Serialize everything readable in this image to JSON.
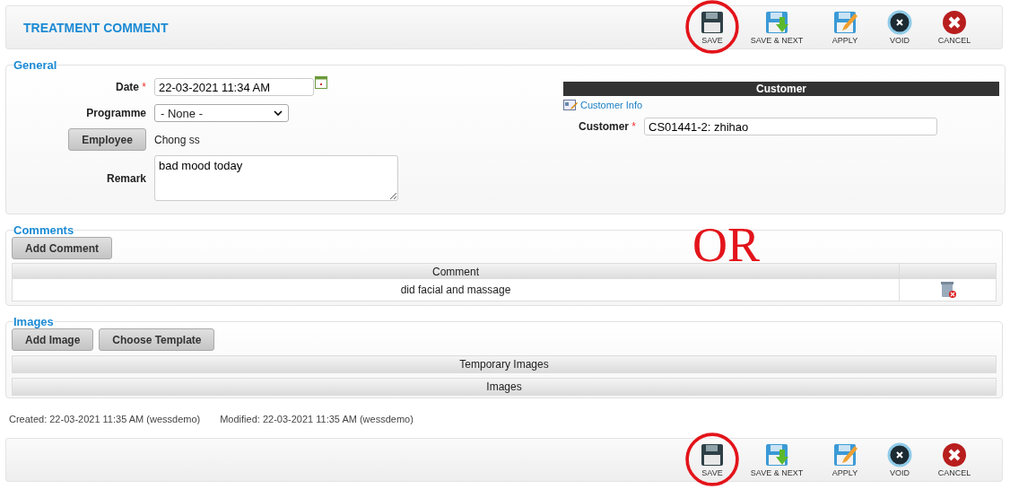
{
  "header": {
    "title": "TREATMENT COMMENT"
  },
  "toolbar_top": [
    {
      "kind": "save",
      "label": "SAVE",
      "highlighted": true
    },
    {
      "kind": "save_next",
      "label": "SAVE & NEXT",
      "highlighted": false
    },
    {
      "kind": "apply",
      "label": "APPLY",
      "highlighted": false
    },
    {
      "kind": "void",
      "label": "VOID",
      "highlighted": false
    },
    {
      "kind": "cancel",
      "label": "CANCEL",
      "highlighted": false
    }
  ],
  "general": {
    "legend": "General",
    "date_label": "Date",
    "date_required": "*",
    "date_value": "22-03-2021 11:34 AM",
    "programme_label": "Programme",
    "programme_value": "- None -",
    "employee_button": "Employee",
    "employee_value": "Chong ss",
    "remark_label": "Remark",
    "remark_value": "bad mood today",
    "customer_header": "Customer",
    "customer_info_link": "Customer Info",
    "customer_label": "Customer",
    "customer_required": "*",
    "customer_value": "CS01441-2: zhihao"
  },
  "annotation": {
    "text": "OR"
  },
  "comments": {
    "legend": "Comments",
    "add_button": "Add Comment",
    "columns": [
      "Comment"
    ],
    "rows": [
      {
        "comment": "did facial and massage"
      }
    ]
  },
  "images": {
    "legend": "Images",
    "buttons": [
      "Add Image",
      "Choose Template"
    ],
    "sections": [
      "Temporary Images",
      "Images"
    ]
  },
  "audit": {
    "created": "Created: 22-03-2021 11:35 AM (wessdemo)",
    "modified": "Modified: 22-03-2021 11:35 AM (wessdemo)"
  },
  "toolbar_bottom": [
    {
      "kind": "save",
      "label": "SAVE",
      "highlighted": true
    },
    {
      "kind": "save_next",
      "label": "SAVE & NEXT",
      "highlighted": false
    },
    {
      "kind": "apply",
      "label": "APPLY",
      "highlighted": false
    },
    {
      "kind": "void",
      "label": "VOID",
      "highlighted": false
    },
    {
      "kind": "cancel",
      "label": "CANCEL",
      "highlighted": false
    }
  ]
}
